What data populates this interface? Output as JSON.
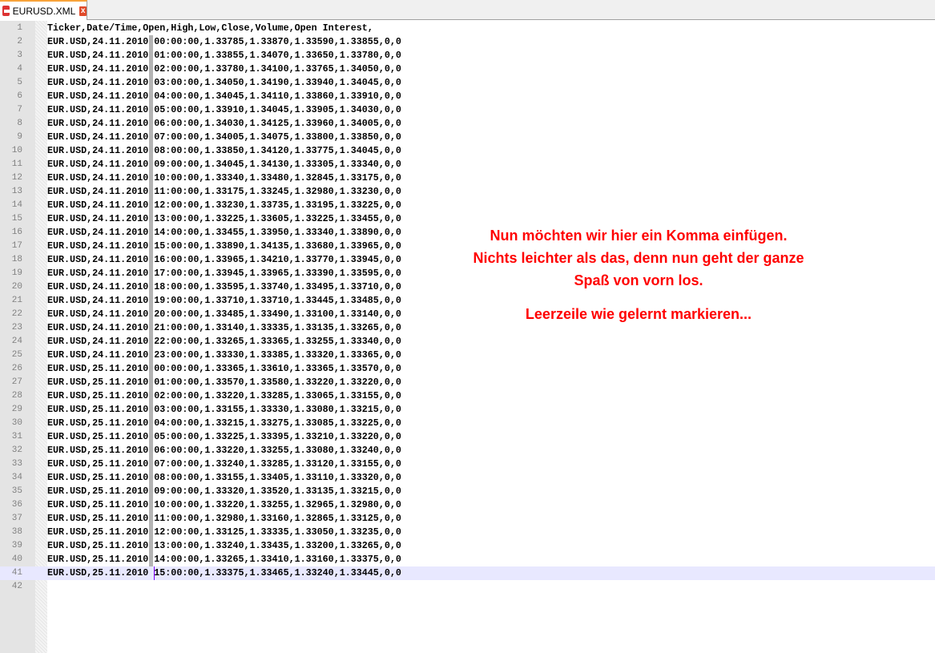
{
  "tab": {
    "title": "EURUSD.XML",
    "close": "x"
  },
  "editor": {
    "current_line": 41,
    "lines": [
      "Ticker,Date/Time,Open,High,Low,Close,Volume,Open Interest,",
      "EUR.USD,24.11.2010 00:00:00,1.33785,1.33870,1.33590,1.33855,0,0",
      "EUR.USD,24.11.2010 01:00:00,1.33855,1.34070,1.33650,1.33780,0,0",
      "EUR.USD,24.11.2010 02:00:00,1.33780,1.34100,1.33765,1.34050,0,0",
      "EUR.USD,24.11.2010 03:00:00,1.34050,1.34190,1.33940,1.34045,0,0",
      "EUR.USD,24.11.2010 04:00:00,1.34045,1.34110,1.33860,1.33910,0,0",
      "EUR.USD,24.11.2010 05:00:00,1.33910,1.34045,1.33905,1.34030,0,0",
      "EUR.USD,24.11.2010 06:00:00,1.34030,1.34125,1.33960,1.34005,0,0",
      "EUR.USD,24.11.2010 07:00:00,1.34005,1.34075,1.33800,1.33850,0,0",
      "EUR.USD,24.11.2010 08:00:00,1.33850,1.34120,1.33775,1.34045,0,0",
      "EUR.USD,24.11.2010 09:00:00,1.34045,1.34130,1.33305,1.33340,0,0",
      "EUR.USD,24.11.2010 10:00:00,1.33340,1.33480,1.32845,1.33175,0,0",
      "EUR.USD,24.11.2010 11:00:00,1.33175,1.33245,1.32980,1.33230,0,0",
      "EUR.USD,24.11.2010 12:00:00,1.33230,1.33735,1.33195,1.33225,0,0",
      "EUR.USD,24.11.2010 13:00:00,1.33225,1.33605,1.33225,1.33455,0,0",
      "EUR.USD,24.11.2010 14:00:00,1.33455,1.33950,1.33340,1.33890,0,0",
      "EUR.USD,24.11.2010 15:00:00,1.33890,1.34135,1.33680,1.33965,0,0",
      "EUR.USD,24.11.2010 16:00:00,1.33965,1.34210,1.33770,1.33945,0,0",
      "EUR.USD,24.11.2010 17:00:00,1.33945,1.33965,1.33390,1.33595,0,0",
      "EUR.USD,24.11.2010 18:00:00,1.33595,1.33740,1.33495,1.33710,0,0",
      "EUR.USD,24.11.2010 19:00:00,1.33710,1.33710,1.33445,1.33485,0,0",
      "EUR.USD,24.11.2010 20:00:00,1.33485,1.33490,1.33100,1.33140,0,0",
      "EUR.USD,24.11.2010 21:00:00,1.33140,1.33335,1.33135,1.33265,0,0",
      "EUR.USD,24.11.2010 22:00:00,1.33265,1.33365,1.33255,1.33340,0,0",
      "EUR.USD,24.11.2010 23:00:00,1.33330,1.33385,1.33320,1.33365,0,0",
      "EUR.USD,25.11.2010 00:00:00,1.33365,1.33610,1.33365,1.33570,0,0",
      "EUR.USD,25.11.2010 01:00:00,1.33570,1.33580,1.33220,1.33220,0,0",
      "EUR.USD,25.11.2010 02:00:00,1.33220,1.33285,1.33065,1.33155,0,0",
      "EUR.USD,25.11.2010 03:00:00,1.33155,1.33330,1.33080,1.33215,0,0",
      "EUR.USD,25.11.2010 04:00:00,1.33215,1.33275,1.33085,1.33225,0,0",
      "EUR.USD,25.11.2010 05:00:00,1.33225,1.33395,1.33210,1.33220,0,0",
      "EUR.USD,25.11.2010 06:00:00,1.33220,1.33255,1.33080,1.33240,0,0",
      "EUR.USD,25.11.2010 07:00:00,1.33240,1.33285,1.33120,1.33155,0,0",
      "EUR.USD,25.11.2010 08:00:00,1.33155,1.33405,1.33110,1.33320,0,0",
      "EUR.USD,25.11.2010 09:00:00,1.33320,1.33520,1.33135,1.33215,0,0",
      "EUR.USD,25.11.2010 10:00:00,1.33220,1.33255,1.32965,1.32980,0,0",
      "EUR.USD,25.11.2010 11:00:00,1.32980,1.33160,1.32865,1.33125,0,0",
      "EUR.USD,25.11.2010 12:00:00,1.33125,1.33335,1.33050,1.33235,0,0",
      "EUR.USD,25.11.2010 13:00:00,1.33240,1.33435,1.33200,1.33265,0,0",
      "EUR.USD,25.11.2010 14:00:00,1.33265,1.33410,1.33160,1.33375,0,0",
      "EUR.USD,25.11.2010 15:00:00,1.33375,1.33465,1.33240,1.33445,0,0",
      ""
    ]
  },
  "annotation": {
    "line1": "Nun möchten wir hier ein Komma einfügen.",
    "line2": "Nichts leichter als das, denn nun geht der ganze",
    "line3": "Spaß von vorn los.",
    "line4": "Leerzeile wie gelernt markieren..."
  },
  "colors": {
    "annotation": "#ff0000",
    "current_line": "#e8e8ff",
    "caret": "#8000ff"
  }
}
